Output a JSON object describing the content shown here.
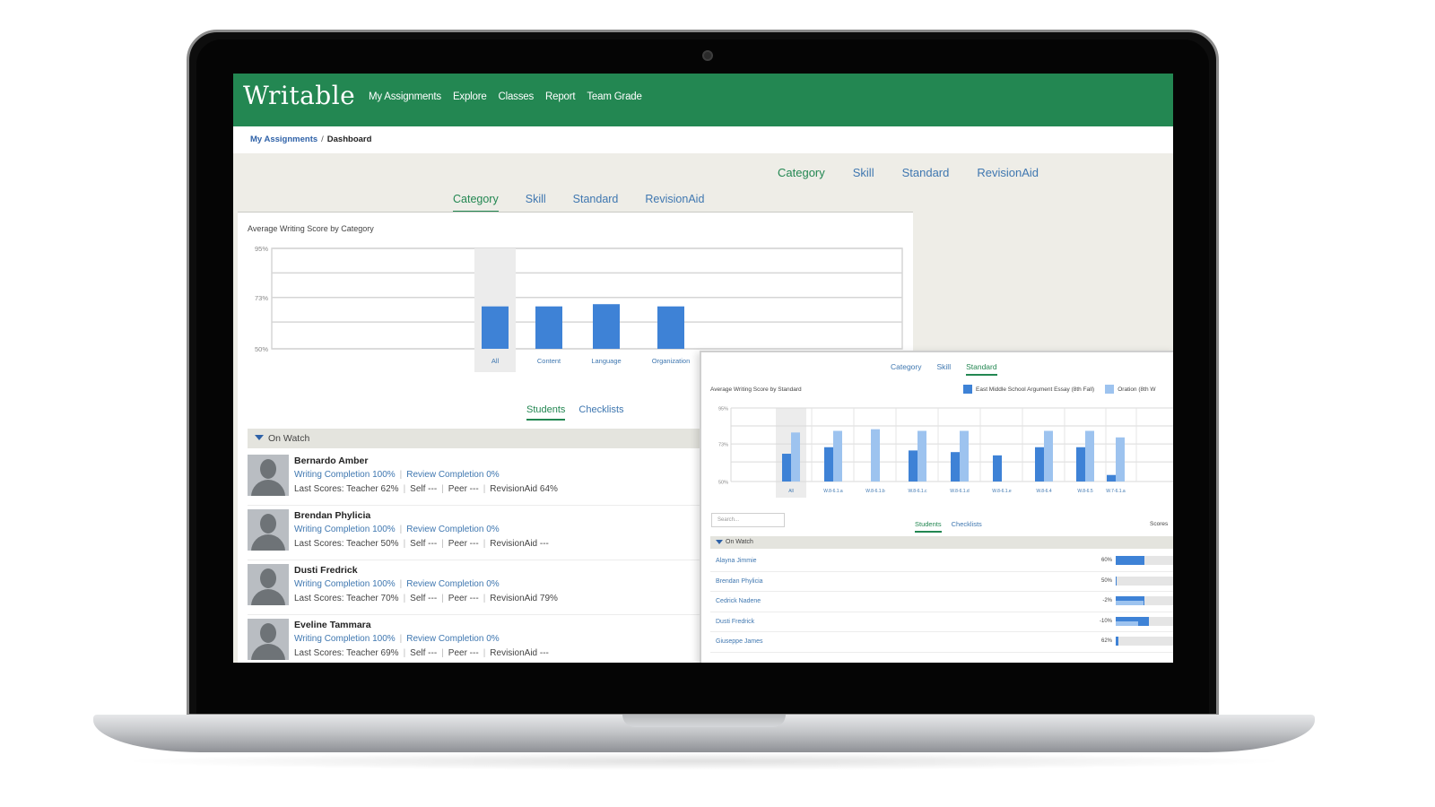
{
  "app": {
    "logo": "Writable"
  },
  "nav": [
    "My Assignments",
    "Explore",
    "Classes",
    "Report",
    "Team Grade"
  ],
  "breadcrumb": {
    "link": "My Assignments",
    "separator": "/",
    "current": "Dashboard"
  },
  "upper_tabs": [
    {
      "label": "Category",
      "active": true
    },
    {
      "label": "Skill",
      "active": false
    },
    {
      "label": "Standard",
      "active": false
    },
    {
      "label": "RevisionAid",
      "active": false
    }
  ],
  "main_tabs": [
    {
      "label": "Category",
      "active": true
    },
    {
      "label": "Skill",
      "active": false
    },
    {
      "label": "Standard",
      "active": false
    },
    {
      "label": "RevisionAid",
      "active": false
    }
  ],
  "colors": {
    "brand": "#238752",
    "link": "#3f77b0",
    "bar": "#3e82d6",
    "bar_light": "#9dc3ef"
  },
  "chart_data": [
    {
      "type": "bar",
      "title": "Average Writing Score by Category",
      "categories": [
        "All",
        "Content",
        "Language",
        "Organization"
      ],
      "values": [
        69,
        69,
        70,
        69
      ],
      "yticks": [
        "95%",
        "73%",
        "50%"
      ],
      "ylim": [
        50,
        95
      ],
      "highlighted": "All",
      "grid": true
    },
    {
      "type": "bar",
      "title": "Average Writing Score by Standard",
      "categories": [
        "All",
        "W.8-6.1.a",
        "W.8-6.1.b",
        "W.8-6.1.c",
        "W.8-6.1.d",
        "W.8-6.1.e",
        "W.8-6.4",
        "W.8-6.5",
        "W.7-6.1.a"
      ],
      "yticks": [
        "95%",
        "73%",
        "50%"
      ],
      "ylim": [
        50,
        95
      ],
      "legend_position": "top-right",
      "series": [
        {
          "name": "East Middle School Argument Essay (8th Fall)",
          "values": [
            67,
            71,
            0,
            69,
            68,
            66,
            71,
            71,
            54
          ]
        },
        {
          "name": "Oration (8th W",
          "values": [
            80,
            81,
            82,
            81,
            81,
            0,
            81,
            81,
            77
          ]
        }
      ]
    }
  ],
  "student_tabs": [
    {
      "label": "Students",
      "active": true
    },
    {
      "label": "Checklists",
      "active": false
    }
  ],
  "watch": {
    "label": "On Watch"
  },
  "students": [
    {
      "name": "Bernardo Amber",
      "writing": "Writing Completion 100%",
      "review": "Review Completion 0%",
      "last_scores": "Last Scores: Teacher 62%",
      "self": "Self ---",
      "peer": "Peer ---",
      "revision": "RevisionAid 64%"
    },
    {
      "name": "Brendan Phylicia",
      "writing": "Writing Completion 100%",
      "review": "Review Completion 0%",
      "last_scores": "Last Scores: Teacher 50%",
      "self": "Self ---",
      "peer": "Peer ---",
      "revision": "RevisionAid ---"
    },
    {
      "name": "Dusti Fredrick",
      "writing": "Writing Completion 100%",
      "review": "Review Completion 0%",
      "last_scores": "Last Scores: Teacher 70%",
      "self": "Self ---",
      "peer": "Peer ---",
      "revision": "RevisionAid 79%"
    },
    {
      "name": "Eveline Tammara",
      "writing": "Writing Completion 100%",
      "review": "Review Completion 0%",
      "last_scores": "Last Scores: Teacher 69%",
      "self": "Self ---",
      "peer": "Peer ---",
      "revision": "RevisionAid ---"
    }
  ],
  "overlay": {
    "tabs": [
      {
        "label": "Category",
        "active": false
      },
      {
        "label": "Skill",
        "active": false
      },
      {
        "label": "Standard",
        "active": true
      }
    ],
    "search_placeholder": "Search...",
    "student_tabs": [
      {
        "label": "Students",
        "active": true
      },
      {
        "label": "Checklists",
        "active": false
      }
    ],
    "scores_label": "Scores",
    "watch_label": "On Watch",
    "rows": [
      {
        "name": "Alayna Jimmie",
        "pct": "60%",
        "fill": 0.46,
        "fill2": 0
      },
      {
        "name": "Brendan Phylicia",
        "pct": "50%",
        "fill": 0.02,
        "fill2": 0
      },
      {
        "name": "Cedrick Nadene",
        "pct": "-2%",
        "fill": 0.46,
        "fill2": 0.44
      },
      {
        "name": "Dusti Fredrick",
        "pct": "-10%",
        "fill": 0.53,
        "fill2": 0.36
      },
      {
        "name": "Giuseppe James",
        "pct": "62%",
        "fill": 0.04,
        "fill2": 0
      }
    ]
  }
}
